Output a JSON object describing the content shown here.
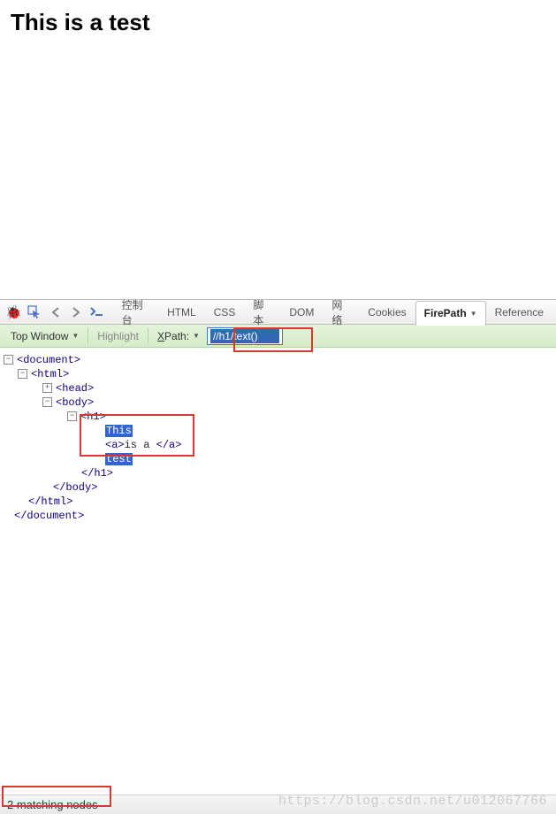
{
  "page": {
    "heading_parts": [
      "This ",
      "is a ",
      "test"
    ]
  },
  "toolbar": {
    "tabs": [
      "控制台",
      "HTML",
      "CSS",
      "脚本",
      "DOM",
      "网络",
      "Cookies",
      "FirePath",
      "Reference"
    ],
    "active_tab": 7
  },
  "subtoolbar": {
    "context_label": "Top Window",
    "highlight_label": "Highlight",
    "xpath_label_first": "X",
    "xpath_label_rest": "Path:",
    "xpath_value": "//h1/text()"
  },
  "dom": {
    "doc_open": "<document>",
    "doc_close": "</document>",
    "html_open": "<html>",
    "html_close": "</html>",
    "head": "<head>",
    "body_open": "<body>",
    "body_close": "</body>",
    "h1_open": "<h1>",
    "h1_close": "</h1>",
    "text1": "This",
    "a_open": "<a>",
    "a_text": "is a ",
    "a_close": "</a>",
    "text2": "test"
  },
  "status": {
    "text": "2 matching nodes"
  },
  "watermark": "https://blog.csdn.net/u012067766"
}
